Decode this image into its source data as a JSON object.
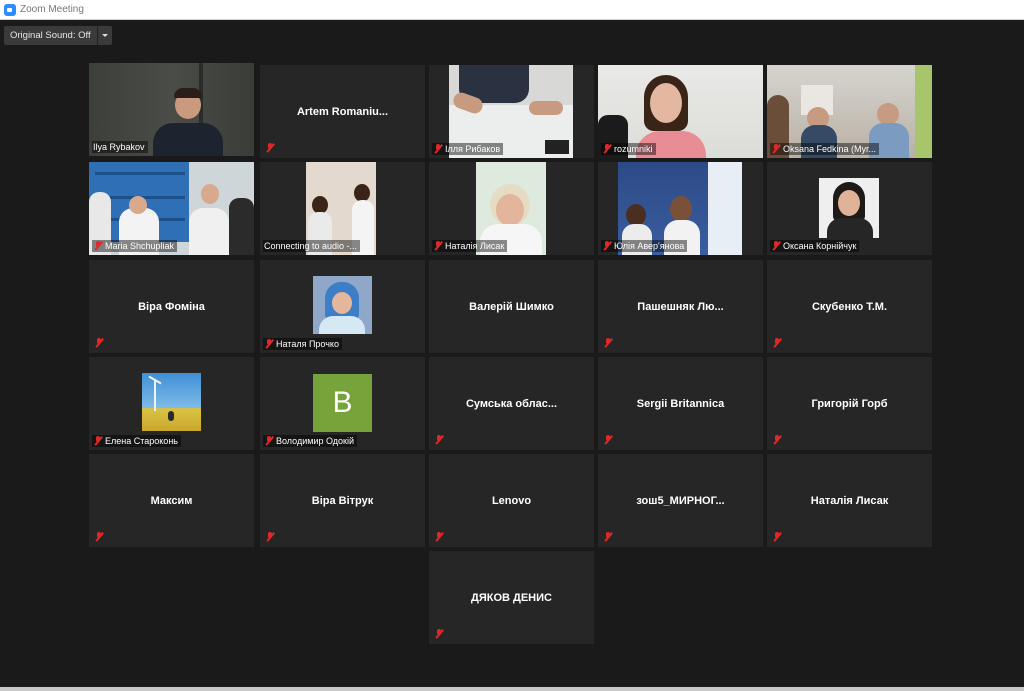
{
  "window": {
    "title": "Zoom Meeting"
  },
  "toolbar": {
    "original_sound_label": "Original Sound: Off"
  },
  "participants": [
    {
      "name": "Ilya Rybakov"
    },
    {
      "name": "Artem  Romaniu..."
    },
    {
      "name": "Ілля Рибаков"
    },
    {
      "name": "rozumniki"
    },
    {
      "name": "Oksana Fedkina (Myr..."
    },
    {
      "name": "Maria Shchupliak"
    },
    {
      "name": "Connecting to audio -..."
    },
    {
      "name": "Наталія Лисак"
    },
    {
      "name": "Юлія Авер'янова"
    },
    {
      "name": "Оксана Корнійчук"
    },
    {
      "name": "Віра Фоміна"
    },
    {
      "name": "Наталя Прочко"
    },
    {
      "name": "Валерій Шимко"
    },
    {
      "name": "Пашешняк  Лю..."
    },
    {
      "name": "Скубенко Т.М."
    },
    {
      "name": "Елена Староконь"
    },
    {
      "name": "Володимир Одокій",
      "avatar_letter": "B"
    },
    {
      "name": "Сумська  облас..."
    },
    {
      "name": "Sergii Britannica"
    },
    {
      "name": "Григорій Горб"
    },
    {
      "name": "Максим"
    },
    {
      "name": "Віра Вітрук"
    },
    {
      "name": "Lenovo"
    },
    {
      "name": "зош5_МИРНОГ..."
    },
    {
      "name": "Наталія Лисак"
    },
    {
      "name": "ДЯКОВ ДЕНИС"
    }
  ],
  "colors": {
    "active_speaker_border": "#c4e27a",
    "muted_icon": "#e02828",
    "avatar_bg": "#76a33a",
    "tile_bg": "#262626"
  }
}
